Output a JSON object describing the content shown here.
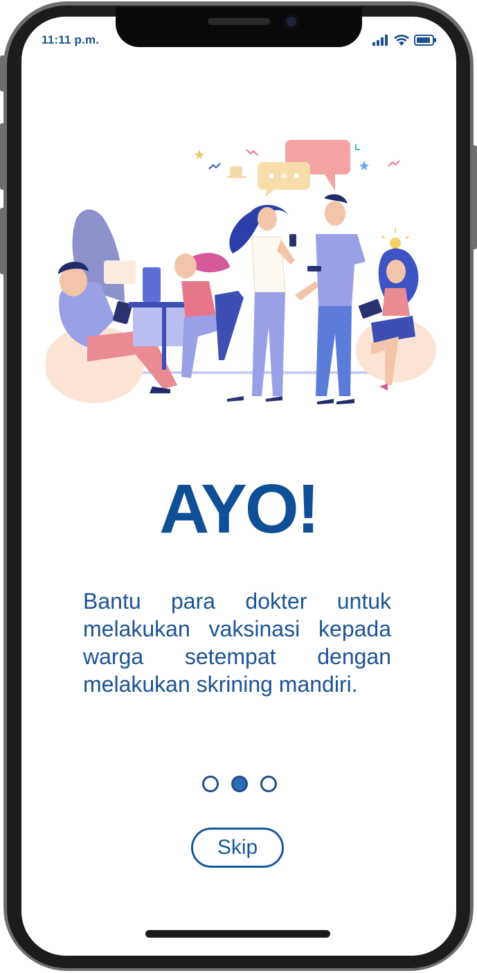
{
  "status_bar": {
    "time": "11:11 p.m.",
    "icons": [
      "signal-icon",
      "wifi-icon",
      "battery-icon"
    ]
  },
  "onboarding": {
    "illustration": "team-collaboration-illustration",
    "headline": "AYO!",
    "description": "Bantu para dokter untuk melakukan vaksinasi kepada warga setempat dengan melakukan skrining mandiri.",
    "pagination": {
      "total": 3,
      "active_index": 1
    },
    "skip_label": "Skip"
  },
  "colors": {
    "primary": "#0f4f96",
    "text": "#1c5296",
    "frame": "#1c1c1c"
  }
}
